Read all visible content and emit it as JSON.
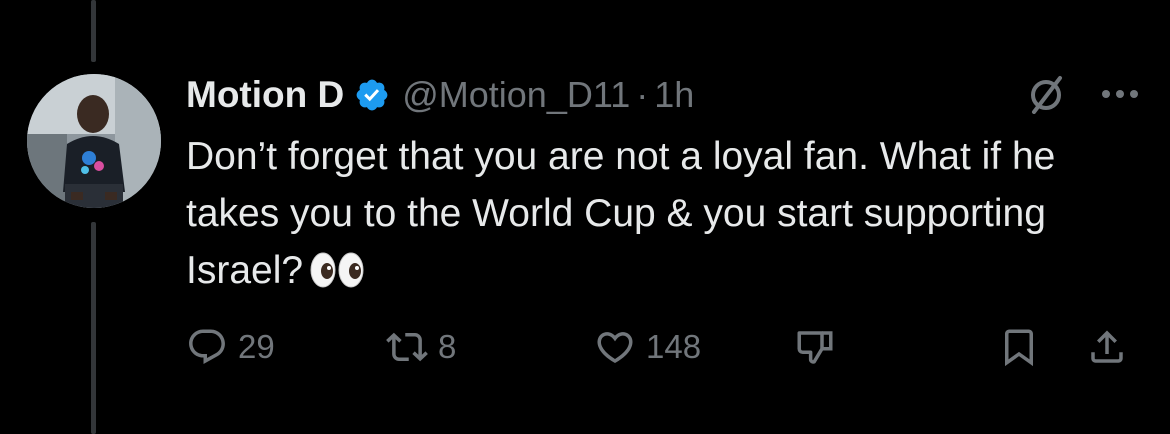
{
  "author": {
    "display_name": "Motion D",
    "handle": "@Motion_D11",
    "separator": "·",
    "time": "1h",
    "verified": true
  },
  "tweet": {
    "text": "Don’t forget that you are not a loyal fan. What if he takes you to the World Cup & you start supporting Israel?",
    "emoji": "eyes-emoji"
  },
  "actions": {
    "replies": "29",
    "reposts": "8",
    "likes": "148"
  },
  "icons": {
    "reply": "reply-icon",
    "repost": "repost-icon",
    "like": "heart-icon",
    "dislike": "thumbs-down-icon",
    "bookmark": "bookmark-icon",
    "share": "share-icon",
    "grok": "grok-icon",
    "more": "more-icon",
    "verified": "verified-badge-icon"
  },
  "colors": {
    "background": "#000000",
    "text": "#e7e9ea",
    "muted": "#71767b",
    "verified": "#1d9bf0"
  }
}
